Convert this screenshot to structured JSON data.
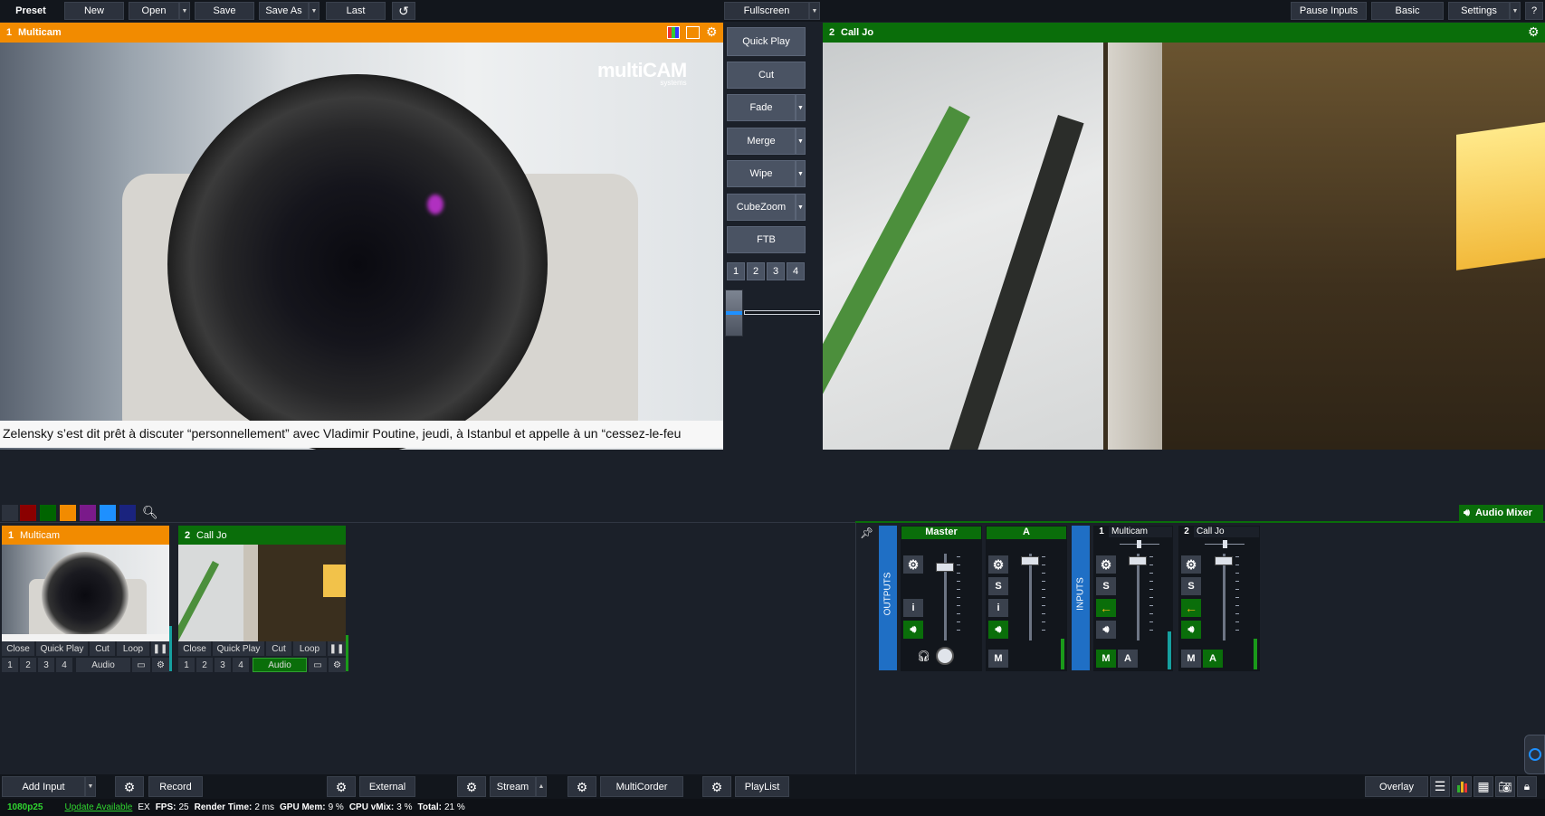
{
  "toolbar": {
    "preset": "Preset",
    "new": "New",
    "open": "Open",
    "save": "Save",
    "save_as": "Save As",
    "last": "Last",
    "fullscreen": "Fullscreen",
    "pause_inputs": "Pause Inputs",
    "basic": "Basic",
    "settings": "Settings",
    "help": "?"
  },
  "preview": {
    "number": "1",
    "title": "Multicam",
    "logo_main": "multiCAM",
    "logo_sub": "systems",
    "ticker": "Zelensky s’est dit prêt à discuter “personnellement” avec Vladimir Poutine, jeudi, à Istanbul et appelle à un “cessez-le-feu"
  },
  "output": {
    "number": "2",
    "title": "Call Jo"
  },
  "transitions": {
    "quick_play": "Quick Play",
    "cut": "Cut",
    "fade": "Fade",
    "merge": "Merge",
    "wipe": "Wipe",
    "cubezoom": "CubeZoom",
    "ftb": "FTB",
    "layers": [
      "1",
      "2",
      "3",
      "4"
    ]
  },
  "colors": {
    "preview_orange": "#f28b00",
    "program_green": "#0a6e0a",
    "tab_red": "#8b0000",
    "tab_green": "#006400",
    "tab_orange": "#f28b00",
    "tab_purple": "#7a1a8a",
    "tab_blue": "#1e90ff",
    "tab_navy": "#1a237e",
    "accent_blue": "#1f6fc5"
  },
  "inputs": [
    {
      "number": "1",
      "title": "Multicam",
      "controls": [
        "Close",
        "Quick Play",
        "Cut",
        "Loop"
      ],
      "layers": [
        "1",
        "2",
        "3",
        "4"
      ],
      "audio": "Audio",
      "audio_active": false
    },
    {
      "number": "2",
      "title": "Call Jo",
      "controls": [
        "Close",
        "Quick Play",
        "Cut",
        "Loop"
      ],
      "layers": [
        "1",
        "2",
        "3",
        "4"
      ],
      "audio": "Audio",
      "audio_active": true
    }
  ],
  "mixer": {
    "title": "Audio Mixer",
    "outputs_label": "OUTPUTS",
    "inputs_label": "INPUTS",
    "master": "Master",
    "bus_a": "A",
    "ch1_num": "1",
    "ch1_name": "Multicam",
    "ch2_num": "2",
    "ch2_name": "Call Jo",
    "s": "S",
    "i": "i",
    "m": "M",
    "a": "A"
  },
  "bottom": {
    "add_input": "Add Input",
    "record": "Record",
    "external": "External",
    "stream": "Stream",
    "multicorder": "MultiCorder",
    "playlist": "PlayList",
    "overlay": "Overlay"
  },
  "status": {
    "resolution": "1080p25",
    "update": "Update Available",
    "ex": "EX",
    "fps_label": "FPS:",
    "fps": "25",
    "render_label": "Render Time:",
    "render": "2 ms",
    "gpu_label": "GPU Mem:",
    "gpu": "9 %",
    "cpu_label": "CPU vMix:",
    "cpu": "3 %",
    "total_label": "Total:",
    "total": "21 %"
  }
}
